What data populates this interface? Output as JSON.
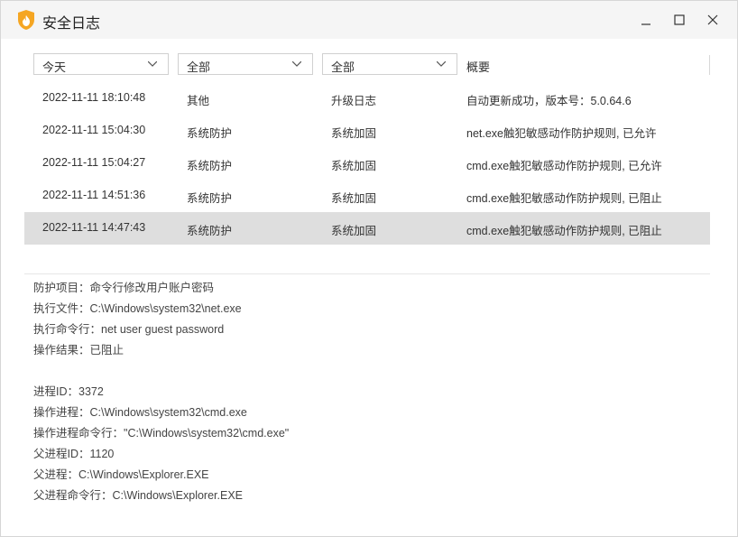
{
  "window": {
    "title": "安全日志"
  },
  "filters": {
    "time_selected": "今天",
    "category_selected": "全部",
    "type_selected": "全部",
    "summary_header": "概要"
  },
  "logs": [
    {
      "time": "2022-11-11 18:10:48",
      "category": "其他",
      "type": "升级日志",
      "summary": "自动更新成功，版本号：5.0.64.6"
    },
    {
      "time": "2022-11-11 15:04:30",
      "category": "系统防护",
      "type": "系统加固",
      "summary": "net.exe触犯敏感动作防护规则, 已允许"
    },
    {
      "time": "2022-11-11 15:04:27",
      "category": "系统防护",
      "type": "系统加固",
      "summary": "cmd.exe触犯敏感动作防护规则, 已允许"
    },
    {
      "time": "2022-11-11 14:51:36",
      "category": "系统防护",
      "type": "系统加固",
      "summary": "cmd.exe触犯敏感动作防护规则, 已阻止"
    },
    {
      "time": "2022-11-11 14:47:43",
      "category": "系统防护",
      "type": "系统加固",
      "summary": "cmd.exe触犯敏感动作防护规则, 已阻止"
    }
  ],
  "details": {
    "protect_item": "防护项目：命令行修改用户账户密码",
    "exec_file": "执行文件：C:\\Windows\\system32\\net.exe",
    "exec_cmd": "执行命令行：net  user guest password",
    "result": "操作结果：已阻止",
    "pid": "进程ID：3372",
    "op_process": "操作进程：C:\\Windows\\system32\\cmd.exe",
    "op_cmd": "操作进程命令行：\"C:\\Windows\\system32\\cmd.exe\"",
    "ppid": "父进程ID：1120",
    "parent": "父进程：C:\\Windows\\Explorer.EXE",
    "parent_cmd": "父进程命令行：C:\\Windows\\Explorer.EXE"
  },
  "colors": {
    "accent_orange": "#f5a623",
    "selected_row": "#dedede"
  }
}
